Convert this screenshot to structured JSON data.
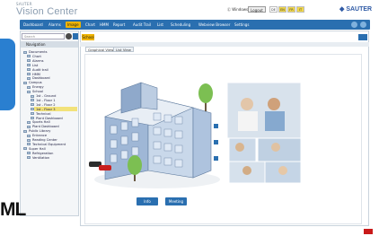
{
  "header": {
    "brand_small": "SAUTER",
    "brand": "Vision Center",
    "user": "Ⓒ Windows",
    "logout": "Logout",
    "languages": [
      "DE",
      "EN",
      "FR",
      "IT"
    ],
    "company": "◆ SAUTER"
  },
  "menu": {
    "items": [
      "Dashboard",
      "Alarms",
      "Image",
      "Chart",
      "HMM",
      "Report",
      "Audit Trail",
      "List",
      "Scheduling",
      "Webview Browser",
      "Settings"
    ],
    "active": "Image"
  },
  "sidebar": {
    "search_placeholder": "Search",
    "header": "Navigation",
    "items": [
      {
        "label": "Documents",
        "level": 0
      },
      {
        "label": "Chart",
        "level": 1
      },
      {
        "label": "Alarms",
        "level": 1
      },
      {
        "label": "List",
        "level": 1
      },
      {
        "label": "Audit trail",
        "level": 1
      },
      {
        "label": "HMM",
        "level": 1
      },
      {
        "label": "Dashboard",
        "level": 1
      },
      {
        "label": "Campus",
        "level": 0
      },
      {
        "label": "Energy",
        "level": 1
      },
      {
        "label": "School",
        "level": 1
      },
      {
        "label": "1st - Ground",
        "level": 2
      },
      {
        "label": "1st - Floor 1",
        "level": 2
      },
      {
        "label": "1st - Floor 2",
        "level": 2
      },
      {
        "label": "1st - Floor 3",
        "level": 2
      },
      {
        "label": "Technical",
        "level": 2
      },
      {
        "label": "Plant Dashboard",
        "level": 2
      },
      {
        "label": "Sports Hall",
        "level": 1
      },
      {
        "label": "Plant Dashboard",
        "level": 1
      },
      {
        "label": "Public Library",
        "level": 0
      },
      {
        "label": "Entrance",
        "level": 1
      },
      {
        "label": "Reading Center",
        "level": 1
      },
      {
        "label": "Technical Equipment",
        "level": 1
      },
      {
        "label": "Super Hall",
        "level": 0
      },
      {
        "label": "Refrigeration",
        "level": 1
      },
      {
        "label": "Ventilation",
        "level": 1
      }
    ],
    "selected": "School"
  },
  "main": {
    "breadcrumb": "School",
    "tabs": [
      "Graphical View",
      "List View"
    ],
    "active_tab": "Graphical View",
    "buttons": [
      "Info",
      "Meeting"
    ]
  },
  "overlay": {
    "bottom_left_text": "ML"
  }
}
